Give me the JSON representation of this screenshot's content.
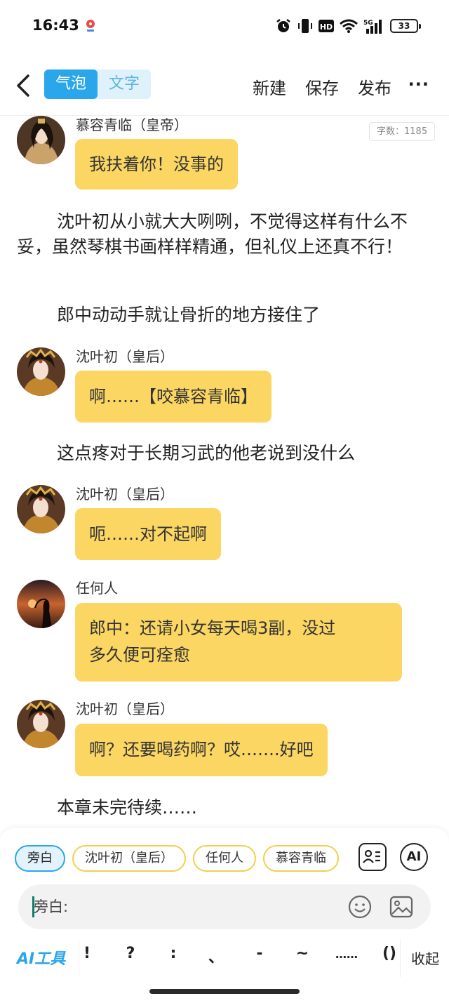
{
  "status_bar": {
    "time": "16:43",
    "network": "5G",
    "hd_label": "HD",
    "battery": "33"
  },
  "header": {
    "tabs": [
      {
        "label": "气泡",
        "active": true
      },
      {
        "label": "文字",
        "active": false
      }
    ],
    "actions": [
      "新建",
      "保存",
      "发布"
    ],
    "more": "···"
  },
  "word_count": "字数：1185",
  "messages": [
    {
      "type": "bubble",
      "speaker": "慕容青临（皇帝）",
      "avatar": "emperor",
      "text": "我扶着你！没事的"
    },
    {
      "type": "narration",
      "text": "沈叶初从小就大大咧咧，不觉得这样有什么不妥，虽然琴棋书画样样精通，但礼仪上还真不行！"
    },
    {
      "type": "narration",
      "text": "郎中动动手就让骨折的地方接住了"
    },
    {
      "type": "bubble",
      "speaker": "沈叶初（皇后）",
      "avatar": "empress",
      "text": "啊……【咬慕容青临】"
    },
    {
      "type": "narration",
      "text": "这点疼对于长期习武的他老说到没什么"
    },
    {
      "type": "bubble",
      "speaker": "沈叶初（皇后）",
      "avatar": "empress",
      "text": "呃……对不起啊"
    },
    {
      "type": "bubble",
      "speaker": "任何人",
      "avatar": "sunset",
      "text_lines": [
        "郎中：还请小女每天喝3副，没过",
        "多久便可痊愈"
      ]
    },
    {
      "type": "bubble",
      "speaker": "沈叶初（皇后）",
      "avatar": "empress",
      "text": "啊？还要喝药啊？哎…….好吧"
    },
    {
      "type": "narration",
      "text": "本章未完待续……"
    }
  ],
  "panel": {
    "roles": [
      "旁白",
      "沈叶初（皇后）",
      "任何人",
      "慕容青临"
    ],
    "ai_button": "AI",
    "input_value": "旁白:",
    "ai_tools_label": "AI工具",
    "punctuation": [
      "!",
      "?",
      ":",
      "、",
      "-",
      "~",
      "……",
      "()"
    ],
    "collapse_label": "收起"
  },
  "colors": {
    "accent": "#2aa6ea",
    "bubble": "#fbd663",
    "chip_border": "#f1cf4f"
  }
}
